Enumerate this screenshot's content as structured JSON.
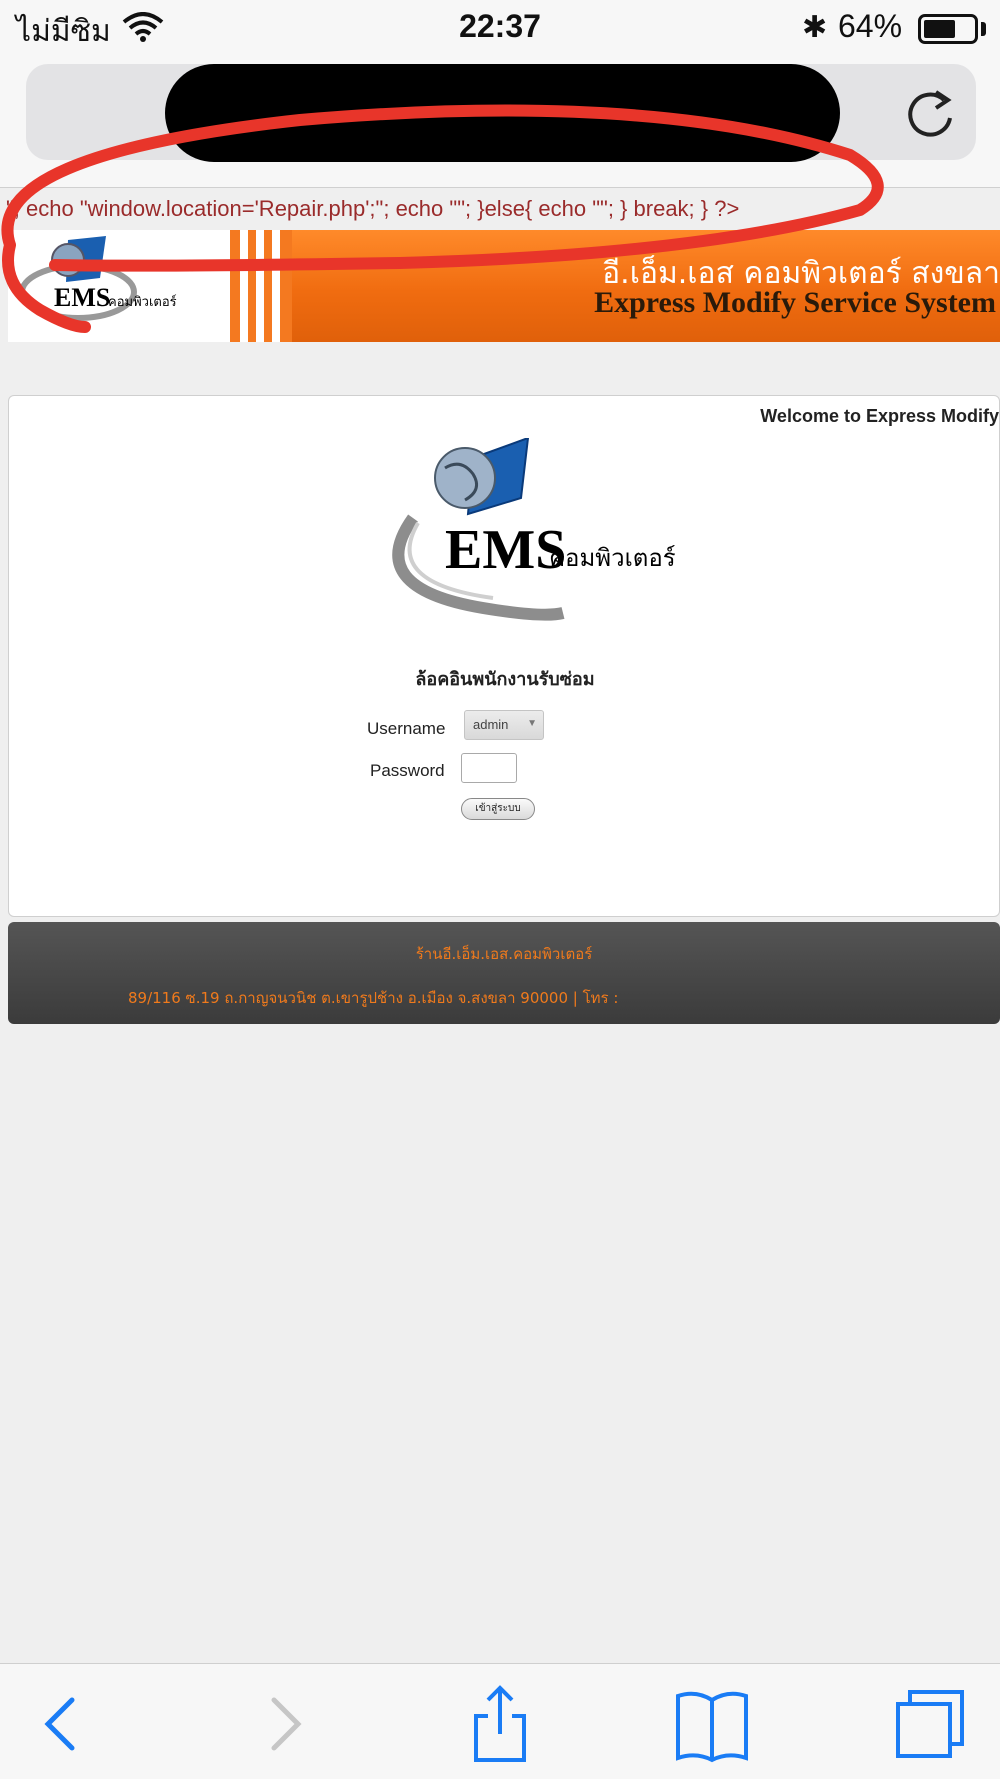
{
  "status_bar": {
    "carrier": "ไม่มีซิม",
    "time": "22:37",
    "bluetooth_glyph": "✱",
    "battery_percent_label": "64%",
    "battery_level": 0.64
  },
  "browser": {
    "url_redacted": true,
    "reload_icon": "reload-icon",
    "toolbar_icons": [
      "back-icon",
      "forward-icon",
      "share-icon",
      "bookmarks-icon",
      "tabs-icon"
    ]
  },
  "page": {
    "raw_php": "\"; echo \"window.location='Repair.php';\"; echo \"\"; }else{ echo \"\"; } break; } ?>",
    "banner": {
      "thai_title": "อี.เอ็ม.เอส คอมพิวเตอร์ สงขลา",
      "english_title": "Express Modify Service System"
    },
    "logo": {
      "ems_text": "EMS",
      "thai_text": "คอมพิวเตอร์"
    },
    "welcome": "Welcome to Express Modify",
    "login": {
      "heading": "ล้อคอินพนักงานรับซ่อม",
      "username_label": "Username",
      "username_value": "admin",
      "password_label": "Password",
      "submit_label": "เข้าสู่ระบบ"
    },
    "footer": {
      "shop_name": "ร้านอี.เอ็ม.เอส.คอมพิวเตอร์",
      "address": "89/116 ซ.19 ถ.กาญจนวนิช ต.เขารูปช้าง อ.เมือง จ.สงขลา 90000 | โทร :"
    },
    "colors": {
      "banner_orange": "#f47920",
      "footer_text": "#f07a1c",
      "annotation_red": "#e8352a"
    }
  }
}
